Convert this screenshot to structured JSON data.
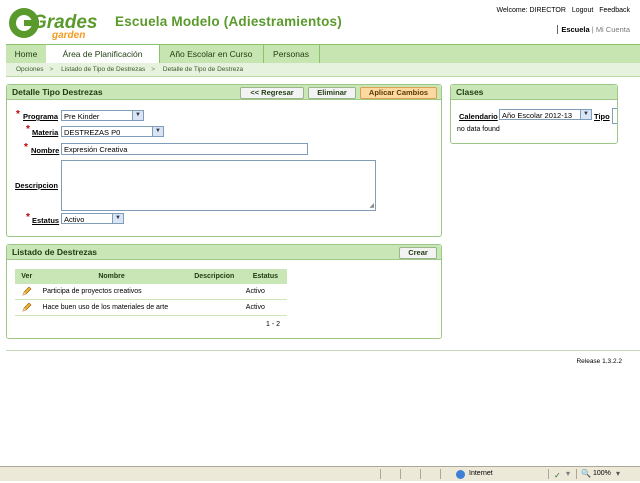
{
  "brand": {
    "logo_line1": "Grades",
    "logo_line2": "garden",
    "school_name": "Escuela Modelo (Adiestramientos)"
  },
  "header": {
    "welcome": "Welcome: DIRECTOR",
    "logout": "Logout",
    "feedback": "Feedback",
    "escuela": "Escuela",
    "mi_cuenta": "Mi Cuenta"
  },
  "nav": {
    "tabs": [
      {
        "label": "Home",
        "active": false
      },
      {
        "label": "Área de Planificación",
        "active": true
      },
      {
        "label": "Año Escolar en Curso",
        "active": false
      },
      {
        "label": "Personas",
        "active": false
      }
    ]
  },
  "breadcrumb": [
    "Opciones",
    "Listado de Tipo de Destrezas",
    "Detalle de Tipo de Destreza"
  ],
  "detail": {
    "title": "Detalle Tipo Destrezas",
    "btn_back": "<< Regresar",
    "btn_delete": "Eliminar",
    "btn_apply": "Aplicar Cambios",
    "programa_label": "Programa",
    "programa_value": "Pre Kinder",
    "materia_label": "Materia",
    "materia_value": "DESTREZAS P0",
    "nombre_label": "Nombre",
    "nombre_value": "Expresión Creativa",
    "descripcion_label": "Descripcion",
    "descripcion_value": "",
    "estatus_label": "Estatus",
    "estatus_value": "Activo",
    "required_mark": "*"
  },
  "clases": {
    "title": "Clases",
    "calendario_label": "Calendario",
    "calendario_value": "Año Escolar 2012-13",
    "tipo_label": "Tipo",
    "no_data": "no data found"
  },
  "listado": {
    "title": "Listado de Destrezas",
    "btn_create": "Crear",
    "columns": [
      "Ver",
      "Nombre",
      "Descripcion",
      "Estatus"
    ],
    "rows": [
      {
        "nombre": "Participa de proyectos creativos",
        "descripcion": "",
        "estatus": "Activo"
      },
      {
        "nombre": "Hace buen uso de los materiales de arte",
        "descripcion": "",
        "estatus": "Activo"
      }
    ],
    "pagination": "1 - 2"
  },
  "footer": {
    "release": "Release 1.3.2.2"
  },
  "statusbar": {
    "zone": "Internet",
    "zoom": "100%"
  },
  "colors": {
    "brand_green": "#5a9a2c",
    "panel_header": "#c9e6b6",
    "required": "#c00000",
    "apply_button": "#fbd9a0"
  }
}
